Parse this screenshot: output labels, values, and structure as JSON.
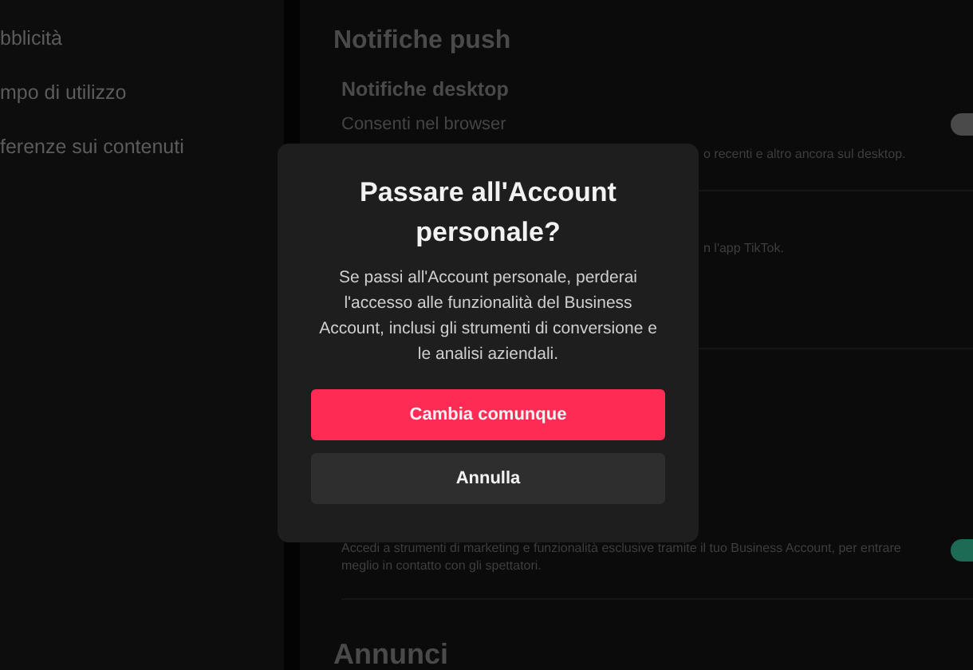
{
  "sidebar": {
    "items": [
      {
        "label": "bblicità"
      },
      {
        "label": "mpo di utilizzo"
      },
      {
        "label": "ferenze sui contenuti"
      }
    ]
  },
  "push_notifications": {
    "heading": "Notifiche push",
    "subheading": "Notifiche desktop",
    "setting": {
      "label": "Consenti nel browser",
      "on": false
    },
    "description_fragment": "o recenti e altro ancora sul desktop.",
    "second_fragment": "n l'app TikTok."
  },
  "business_account": {
    "on": true,
    "description": "Accedi a strumenti di marketing e funzionalità esclusive tramite il tuo Business Account, per entrare meglio in contatto con gli spettatori."
  },
  "next_heading": "Annunci",
  "dialog": {
    "title": "Passare all'Account personale?",
    "message": "Se passi all'Account personale, perderai l'accesso alle funzionalità del Business Account, inclusi gli strumenti di conversione e le analisi aziendali.",
    "buttons": [
      {
        "label": "Cambia comunque",
        "kind": "primary"
      },
      {
        "label": "Annulla",
        "kind": "secondary"
      }
    ]
  }
}
